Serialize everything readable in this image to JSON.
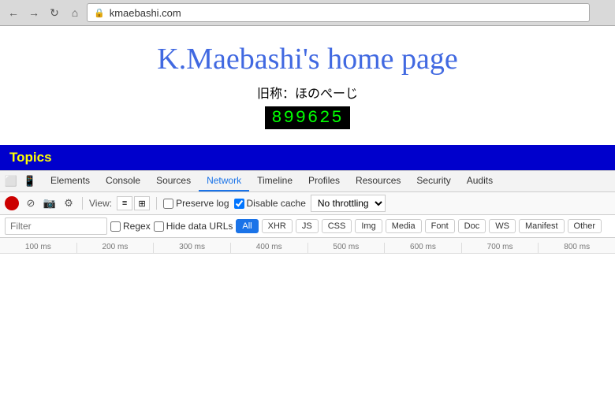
{
  "browser": {
    "url": "kmaebashi.com",
    "back_label": "←",
    "forward_label": "→",
    "reload_label": "↻",
    "home_label": "⌂"
  },
  "page": {
    "title": "K.Maebashi's home page",
    "subtitle": "旧称：ほのぺーじ",
    "counter": "899625"
  },
  "topics_bar": {
    "label": "Topics"
  },
  "devtools": {
    "tabs": [
      {
        "label": "Elements",
        "active": false
      },
      {
        "label": "Console",
        "active": false
      },
      {
        "label": "Sources",
        "active": false
      },
      {
        "label": "Network",
        "active": true
      },
      {
        "label": "Timeline",
        "active": false
      },
      {
        "label": "Profiles",
        "active": false
      },
      {
        "label": "Resources",
        "active": false
      },
      {
        "label": "Security",
        "active": false
      },
      {
        "label": "Audits",
        "active": false
      }
    ],
    "toolbar": {
      "view_label": "View:",
      "preserve_log_label": "Preserve log",
      "disable_cache_label": "Disable cache",
      "disable_cache_checked": true,
      "throttle_label": "No throttling"
    },
    "filter": {
      "placeholder": "Filter",
      "regex_label": "Regex",
      "hide_data_urls_label": "Hide data URLs",
      "chips": [
        "All",
        "XHR",
        "JS",
        "CSS",
        "Img",
        "Media",
        "Font",
        "Doc",
        "WS",
        "Manifest",
        "Other"
      ]
    },
    "ruler": {
      "ticks": [
        "100 ms",
        "200 ms",
        "300 ms",
        "400 ms",
        "500 ms",
        "600 ms",
        "700 ms",
        "800 ms"
      ]
    }
  }
}
